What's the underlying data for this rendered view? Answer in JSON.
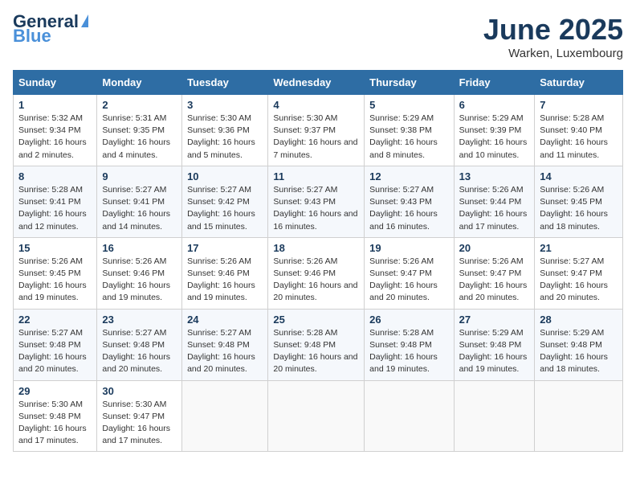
{
  "logo": {
    "general": "General",
    "blue": "Blue"
  },
  "title": "June 2025",
  "location": "Warken, Luxembourg",
  "days_of_week": [
    "Sunday",
    "Monday",
    "Tuesday",
    "Wednesday",
    "Thursday",
    "Friday",
    "Saturday"
  ],
  "weeks": [
    [
      {
        "num": "1",
        "sunrise": "5:32 AM",
        "sunset": "9:34 PM",
        "daylight": "16 hours and 2 minutes."
      },
      {
        "num": "2",
        "sunrise": "5:31 AM",
        "sunset": "9:35 PM",
        "daylight": "16 hours and 4 minutes."
      },
      {
        "num": "3",
        "sunrise": "5:30 AM",
        "sunset": "9:36 PM",
        "daylight": "16 hours and 5 minutes."
      },
      {
        "num": "4",
        "sunrise": "5:30 AM",
        "sunset": "9:37 PM",
        "daylight": "16 hours and 7 minutes."
      },
      {
        "num": "5",
        "sunrise": "5:29 AM",
        "sunset": "9:38 PM",
        "daylight": "16 hours and 8 minutes."
      },
      {
        "num": "6",
        "sunrise": "5:29 AM",
        "sunset": "9:39 PM",
        "daylight": "16 hours and 10 minutes."
      },
      {
        "num": "7",
        "sunrise": "5:28 AM",
        "sunset": "9:40 PM",
        "daylight": "16 hours and 11 minutes."
      }
    ],
    [
      {
        "num": "8",
        "sunrise": "5:28 AM",
        "sunset": "9:41 PM",
        "daylight": "16 hours and 12 minutes."
      },
      {
        "num": "9",
        "sunrise": "5:27 AM",
        "sunset": "9:41 PM",
        "daylight": "16 hours and 14 minutes."
      },
      {
        "num": "10",
        "sunrise": "5:27 AM",
        "sunset": "9:42 PM",
        "daylight": "16 hours and 15 minutes."
      },
      {
        "num": "11",
        "sunrise": "5:27 AM",
        "sunset": "9:43 PM",
        "daylight": "16 hours and 16 minutes."
      },
      {
        "num": "12",
        "sunrise": "5:27 AM",
        "sunset": "9:43 PM",
        "daylight": "16 hours and 16 minutes."
      },
      {
        "num": "13",
        "sunrise": "5:26 AM",
        "sunset": "9:44 PM",
        "daylight": "16 hours and 17 minutes."
      },
      {
        "num": "14",
        "sunrise": "5:26 AM",
        "sunset": "9:45 PM",
        "daylight": "16 hours and 18 minutes."
      }
    ],
    [
      {
        "num": "15",
        "sunrise": "5:26 AM",
        "sunset": "9:45 PM",
        "daylight": "16 hours and 19 minutes."
      },
      {
        "num": "16",
        "sunrise": "5:26 AM",
        "sunset": "9:46 PM",
        "daylight": "16 hours and 19 minutes."
      },
      {
        "num": "17",
        "sunrise": "5:26 AM",
        "sunset": "9:46 PM",
        "daylight": "16 hours and 19 minutes."
      },
      {
        "num": "18",
        "sunrise": "5:26 AM",
        "sunset": "9:46 PM",
        "daylight": "16 hours and 20 minutes."
      },
      {
        "num": "19",
        "sunrise": "5:26 AM",
        "sunset": "9:47 PM",
        "daylight": "16 hours and 20 minutes."
      },
      {
        "num": "20",
        "sunrise": "5:26 AM",
        "sunset": "9:47 PM",
        "daylight": "16 hours and 20 minutes."
      },
      {
        "num": "21",
        "sunrise": "5:27 AM",
        "sunset": "9:47 PM",
        "daylight": "16 hours and 20 minutes."
      }
    ],
    [
      {
        "num": "22",
        "sunrise": "5:27 AM",
        "sunset": "9:48 PM",
        "daylight": "16 hours and 20 minutes."
      },
      {
        "num": "23",
        "sunrise": "5:27 AM",
        "sunset": "9:48 PM",
        "daylight": "16 hours and 20 minutes."
      },
      {
        "num": "24",
        "sunrise": "5:27 AM",
        "sunset": "9:48 PM",
        "daylight": "16 hours and 20 minutes."
      },
      {
        "num": "25",
        "sunrise": "5:28 AM",
        "sunset": "9:48 PM",
        "daylight": "16 hours and 20 minutes."
      },
      {
        "num": "26",
        "sunrise": "5:28 AM",
        "sunset": "9:48 PM",
        "daylight": "16 hours and 19 minutes."
      },
      {
        "num": "27",
        "sunrise": "5:29 AM",
        "sunset": "9:48 PM",
        "daylight": "16 hours and 19 minutes."
      },
      {
        "num": "28",
        "sunrise": "5:29 AM",
        "sunset": "9:48 PM",
        "daylight": "16 hours and 18 minutes."
      }
    ],
    [
      {
        "num": "29",
        "sunrise": "5:30 AM",
        "sunset": "9:48 PM",
        "daylight": "16 hours and 17 minutes."
      },
      {
        "num": "30",
        "sunrise": "5:30 AM",
        "sunset": "9:47 PM",
        "daylight": "16 hours and 17 minutes."
      },
      null,
      null,
      null,
      null,
      null
    ]
  ],
  "labels": {
    "sunrise": "Sunrise: ",
    "sunset": "Sunset: ",
    "daylight": "Daylight: "
  }
}
